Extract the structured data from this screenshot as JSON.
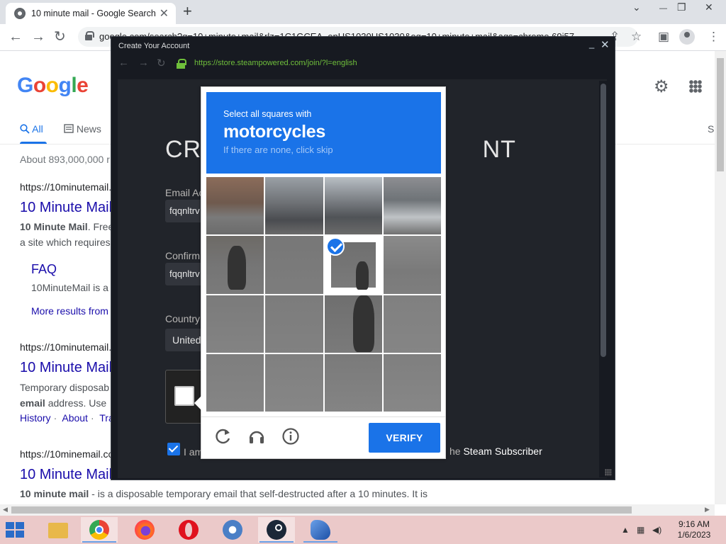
{
  "browser": {
    "tab_title": "10 minute mail - Google Search",
    "tab_close": "✕",
    "new_tab": "+",
    "url": "google.com/search?q=10+minute+mail&rlz=1C1GCEA_enUS1030US1030&oq=10+minute+mail&aqs=chrome.69i57",
    "window_controls": {
      "chevron": "⌄",
      "minimize": "—",
      "restore": "❐",
      "close": "✕"
    },
    "nav": {
      "back": "←",
      "forward": "→",
      "reload": "↻"
    }
  },
  "google": {
    "logo_letters": [
      "G",
      "o",
      "o",
      "g",
      "l",
      "e"
    ],
    "tabs": [
      {
        "label": "All",
        "icon": "search-icon"
      },
      {
        "label": "News",
        "icon": "news-icon"
      }
    ],
    "tab_overflow": "S",
    "stats": "About 893,000,000 r",
    "results": [
      {
        "url": "https://10minutemail.",
        "title": "10 Minute Mail",
        "snippet_bold": "10 Minute Mail",
        "snippet": ". Free",
        "snippet2": "a site which requires",
        "sublink_title": "FAQ",
        "sublink_snippet": "10MinuteMail is a",
        "more": "More results from"
      },
      {
        "url": "https://10minutemail.",
        "title": "10 Minute Mail",
        "snippet": "Temporary disposab",
        "snippet2_bold": "email",
        "snippet2": " address. Use",
        "links": [
          "History",
          "About",
          "Tra"
        ]
      },
      {
        "url": "https://10minemail.co",
        "title": "10 Minute Mail",
        "snippet_bold": "10 minute mail",
        "snippet": " - is a disposable temporary email that self-destructed after a 10 minutes. It is"
      }
    ]
  },
  "steam_window": {
    "title": "Create Your Account",
    "minimize": "_",
    "close": "✕",
    "url": "https://store.steampowered.com/join/?l=english",
    "page_title_left": "CRI",
    "page_title_right": "NT",
    "email_label": "Email Ac",
    "email_value": "fqqnltrv",
    "confirm_label": "Confirm",
    "confirm_value": "fqqnltrv",
    "country_label": "Country",
    "country_value": "United",
    "agree_text": "I am",
    "agree_text_right_prefix": "he ",
    "agree_text_right": "Steam Subscriber"
  },
  "captcha": {
    "instruction": "Select all squares with",
    "target": "motorcycles",
    "hint": "If there are none, click skip",
    "selected_tiles": [
      6
    ],
    "verify_label": "VERIFY",
    "icons": [
      "reload-icon",
      "audio-icon",
      "info-icon"
    ]
  },
  "taskbar": {
    "apps": [
      "file-explorer-icon",
      "chrome-icon",
      "firefox-icon",
      "opera-icon",
      "app-icon",
      "steam-icon",
      "ship-icon"
    ],
    "time": "9:16 AM",
    "date": "1/6/2023"
  },
  "colors": {
    "accent": "#1a73e8",
    "steam_bg": "#171a21",
    "taskbar": "#ebc9c9",
    "link": "#1a0dab"
  }
}
